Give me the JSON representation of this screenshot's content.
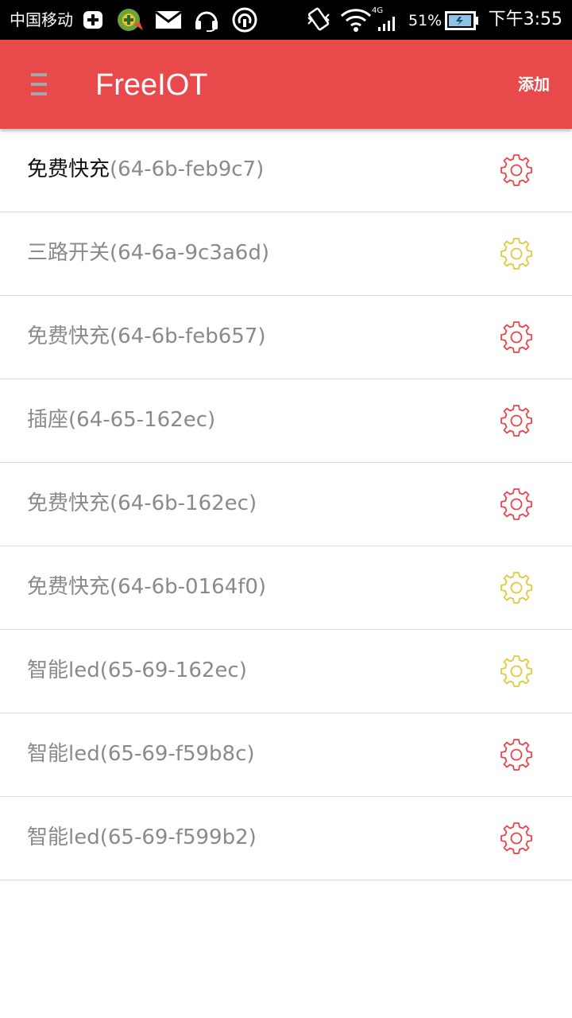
{
  "status_bar": {
    "carrier": "中国移动",
    "network": "4G",
    "battery_percent": "51%",
    "time": "下午3:55",
    "icons": [
      "plus-box-icon",
      "app-badge-icon",
      "mail-icon",
      "headset-icon",
      "broadcast-icon",
      "vibrate-icon",
      "wifi-icon",
      "signal-icon",
      "battery-icon"
    ]
  },
  "app_bar": {
    "title": "FreeIOT",
    "add_label": "添加",
    "menu_icon": "hamburger-menu-icon",
    "color": "#e84a4b"
  },
  "devices": [
    {
      "name": "免费快充",
      "id": "(64-6b-feb9c7)",
      "gear_color": "#e8454a",
      "active": true
    },
    {
      "name": "三路开关",
      "id": "(64-6a-9c3a6d)",
      "gear_color": "#e2c93a",
      "active": false
    },
    {
      "name": "免费快充",
      "id": "(64-6b-feb657)",
      "gear_color": "#e8454a",
      "active": false
    },
    {
      "name": "插座",
      "id": "(64-65-162ec)",
      "gear_color": "#e8454a",
      "active": false
    },
    {
      "name": "免费快充",
      "id": "(64-6b-162ec)",
      "gear_color": "#e8454a",
      "active": false
    },
    {
      "name": "免费快充",
      "id": "(64-6b-0164f0)",
      "gear_color": "#e2c93a",
      "active": false
    },
    {
      "name": "智能led",
      "id": "(65-69-162ec)",
      "gear_color": "#e2c93a",
      "active": false
    },
    {
      "name": "智能led",
      "id": "(65-69-f59b8c)",
      "gear_color": "#e8454a",
      "active": false
    },
    {
      "name": "智能led",
      "id": "(65-69-f599b2)",
      "gear_color": "#e8454a",
      "active": false
    }
  ]
}
